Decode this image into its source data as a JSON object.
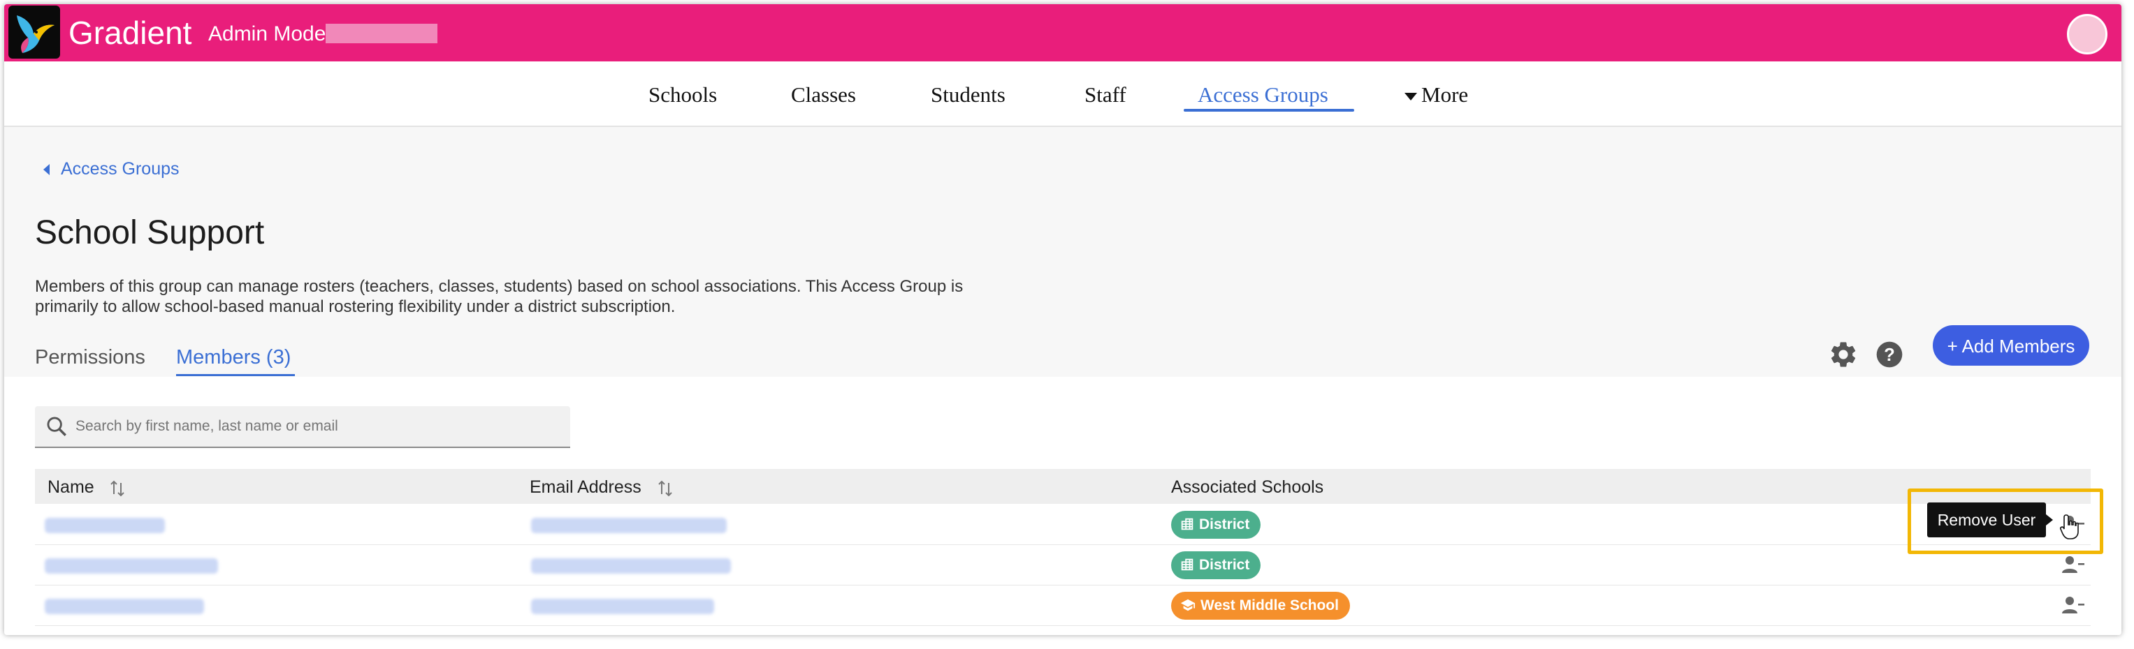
{
  "header": {
    "brand": "Gradient",
    "mode_label": "Admin Mode",
    "accent_color": "#e91e7b"
  },
  "nav": {
    "items": [
      {
        "label": "Schools"
      },
      {
        "label": "Classes"
      },
      {
        "label": "Students"
      },
      {
        "label": "Staff"
      },
      {
        "label": "Access Groups",
        "active": true
      },
      {
        "label": "More",
        "icon": "caret-down-icon"
      }
    ]
  },
  "breadcrumb": {
    "label": "Access Groups"
  },
  "page": {
    "title": "School Support",
    "description": "Members of this group can manage rosters (teachers, classes, students) based on school associations. This Access Group is primarily to allow school-based manual rostering flexibility under a district subscription."
  },
  "tabs": [
    {
      "label": "Permissions"
    },
    {
      "label": "Members (3)",
      "active": true
    }
  ],
  "actions": {
    "add_members_label": "+ Add Members",
    "icons": [
      "gear-icon",
      "help-icon"
    ]
  },
  "search": {
    "placeholder": "Search by first name, last name or email"
  },
  "table": {
    "headers": {
      "name": "Name",
      "email": "Email Address",
      "schools": "Associated Schools"
    },
    "rows": [
      {
        "school": "District",
        "badge_type": "district"
      },
      {
        "school": "District",
        "badge_type": "district"
      },
      {
        "school": "West Middle School",
        "badge_type": "school"
      }
    ],
    "badge_colors": {
      "district": "#4caf8d",
      "school": "#f5902c"
    }
  },
  "tooltip": {
    "label": "Remove User"
  }
}
